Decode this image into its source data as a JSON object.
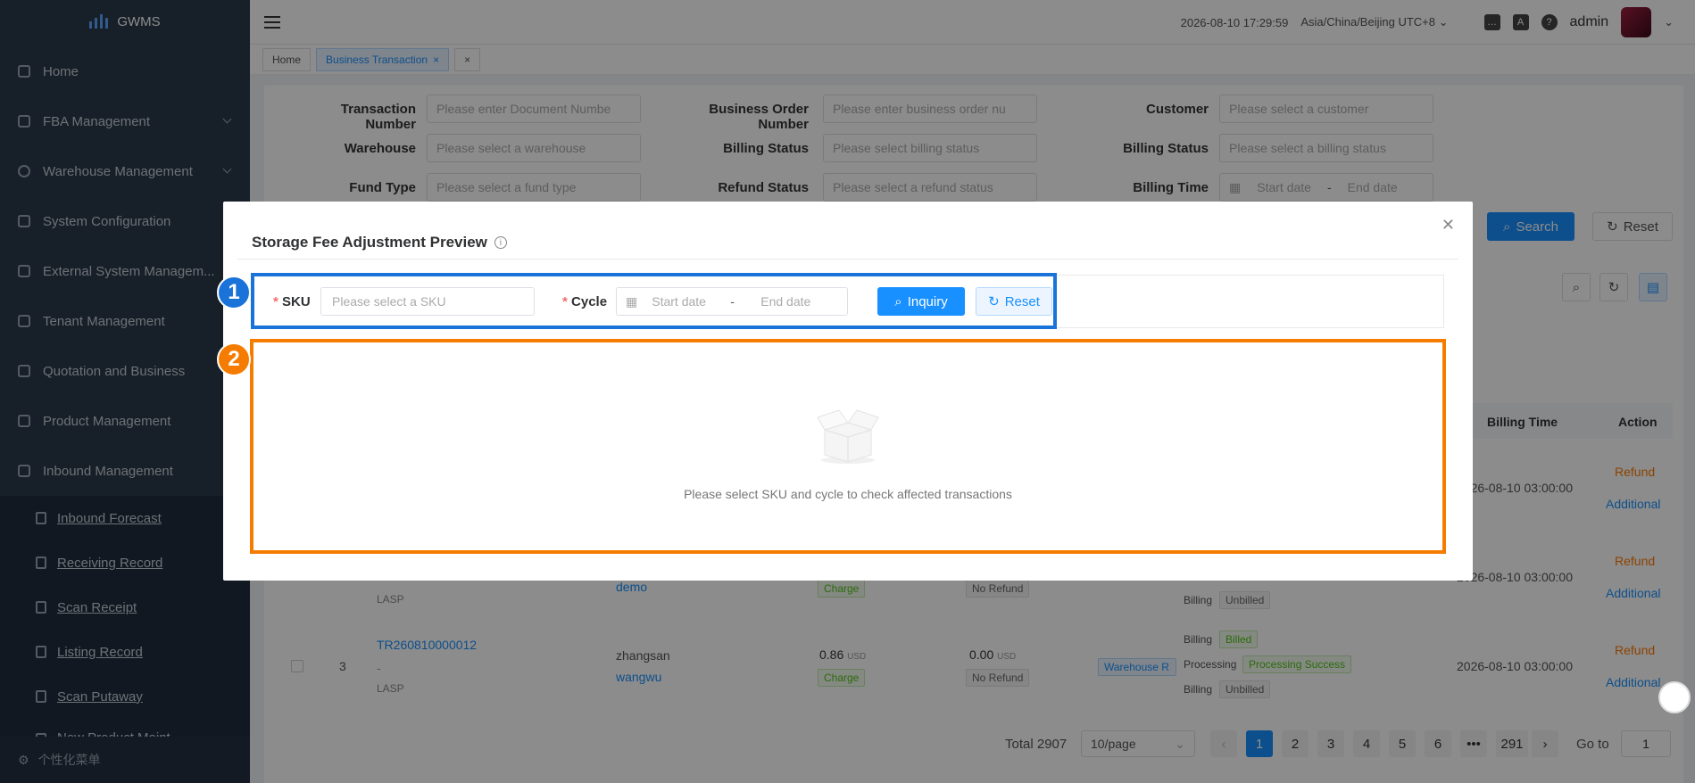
{
  "app": {
    "name": "GWMS"
  },
  "sidebar": {
    "items": [
      {
        "label": "Home",
        "icon": "dashboard-icon"
      },
      {
        "label": "FBA Management",
        "icon": "box-icon"
      },
      {
        "label": "Warehouse Management",
        "icon": "globe-icon"
      },
      {
        "label": "System Configuration",
        "icon": "config-icon"
      },
      {
        "label": "External System Managem...",
        "icon": "grid-icon"
      },
      {
        "label": "Tenant Management",
        "icon": "bar-chart-icon"
      },
      {
        "label": "Quotation and Business",
        "icon": "document-icon"
      },
      {
        "label": "Product Management",
        "icon": "cart-icon"
      },
      {
        "label": "Inbound Management",
        "icon": "home-icon"
      }
    ],
    "subitems": [
      {
        "label": "Inbound Forecast"
      },
      {
        "label": "Receiving Record"
      },
      {
        "label": "Scan Receipt"
      },
      {
        "label": "Listing Record"
      },
      {
        "label": "Scan Putaway"
      },
      {
        "label": "New Product Maint..."
      }
    ],
    "footer": "个性化菜单"
  },
  "header": {
    "datetime": "2026-08-10 17:29:59",
    "timezone": "Asia/China/Beijing UTC+8",
    "user": "admin"
  },
  "tabs": [
    {
      "label": "Home"
    },
    {
      "label": "Business Transaction"
    }
  ],
  "filters": {
    "transaction_number": {
      "label": "Transaction Number",
      "placeholder": "Please enter Document Numbe"
    },
    "business_order_number": {
      "label": "Business Order Number",
      "placeholder": "Please enter business order nu"
    },
    "customer": {
      "label": "Customer",
      "placeholder": "Please select a customer"
    },
    "warehouse": {
      "label": "Warehouse",
      "placeholder": "Please select a warehouse"
    },
    "billing_status_1": {
      "label": "Billing Status",
      "placeholder": "Please select billing status"
    },
    "billing_status_2": {
      "label": "Billing Status",
      "placeholder": "Please select a billing status"
    },
    "fund_type": {
      "label": "Fund Type",
      "placeholder": "Please select a fund type"
    },
    "refund_status": {
      "label": "Refund Status",
      "placeholder": "Please select a refund status"
    },
    "billing_time": {
      "label": "Billing Time",
      "start": "Start date",
      "sep": "-",
      "end": "End date"
    },
    "search": "Search",
    "reset": "Reset"
  },
  "table": {
    "headers": {
      "billing_time": "Billing Time",
      "action": "Action"
    },
    "rows": [
      {
        "billing_time": "2026-08-10 03:00:00",
        "refund": "Refund",
        "additional": "Additional"
      },
      {
        "customer2": "demo",
        "fund": "Charge",
        "refund_status": "No Refund",
        "source": "LASP",
        "billing_label": "Billing",
        "billing_status": "Unbilled",
        "billing_time": "2026-08-10 03:00:00",
        "refund": "Refund",
        "additional": "Additional"
      },
      {
        "no": "3",
        "txn": "TR260810000012",
        "dash": "-",
        "source": "LASP",
        "customer1": "zhangsan",
        "customer2": "wangwu",
        "amount": "0.86",
        "currency": "USD",
        "fund": "Charge",
        "refund_amount": "0.00",
        "refund_currency": "USD",
        "refund_status": "No Refund",
        "warehouse_tag": "Warehouse R",
        "billing_label": "Billing",
        "billing_status": "Billed",
        "processing_label": "Processing",
        "processing_status": "Processing Success",
        "billing_label2": "Billing",
        "billing_status2": "Unbilled",
        "billing_time": "2026-08-10 03:00:00",
        "refund": "Refund",
        "additional": "Additional"
      }
    ]
  },
  "pagination": {
    "total": "Total 2907",
    "page_size": "10/page",
    "pages": [
      "1",
      "2",
      "3",
      "4",
      "5",
      "6",
      "•••",
      "291"
    ],
    "goto_label": "Go to",
    "goto_value": "1"
  },
  "modal": {
    "title": "Storage Fee Adjustment Preview",
    "sku_label": "SKU",
    "sku_placeholder": "Please select a SKU",
    "cycle_label": "Cycle",
    "start_date": "Start date",
    "sep": "-",
    "end_date": "End date",
    "inquiry": "Inquiry",
    "reset": "Reset",
    "required_mark": "*",
    "empty_text": "Please select SKU and cycle to check affected transactions"
  },
  "annotations": [
    {
      "number": "1",
      "color": "#1a73d9"
    },
    {
      "number": "2",
      "color": "#f57c00"
    }
  ]
}
